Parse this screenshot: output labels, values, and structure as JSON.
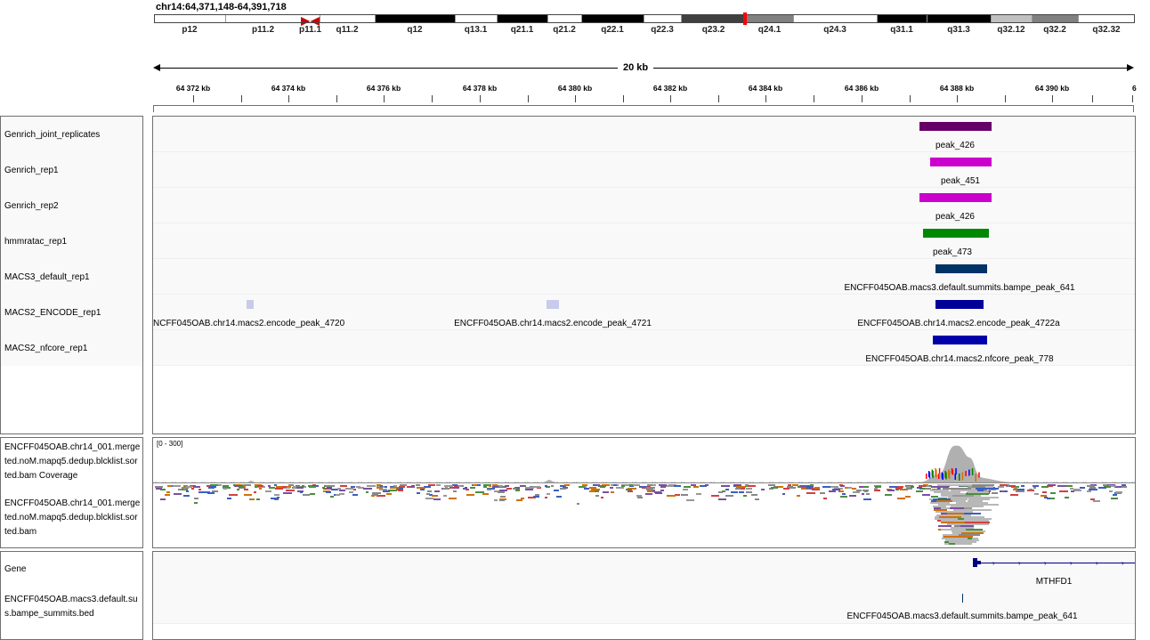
{
  "header": {
    "locus": "chr14:64,371,148-64,391,718",
    "scale_label": "20 kb"
  },
  "ideogram": {
    "bands": [
      {
        "label": "p12",
        "start": 0,
        "end": 80,
        "color": "#ffffff"
      },
      {
        "label": "p11.2",
        "start": 80,
        "end": 165,
        "color": "#ffffff"
      },
      {
        "label": "p11.1",
        "start": 165,
        "end": 186,
        "color": "#ffffff",
        "centromere": true
      },
      {
        "label": "q11.2",
        "start": 186,
        "end": 248,
        "color": "#ffffff"
      },
      {
        "label": "q12",
        "start": 248,
        "end": 338,
        "color": "#000000"
      },
      {
        "label": "q13.1",
        "start": 338,
        "end": 385,
        "color": "#ffffff"
      },
      {
        "label": "q21.1",
        "start": 385,
        "end": 442,
        "color": "#000000"
      },
      {
        "label": "q21.2",
        "start": 442,
        "end": 480,
        "color": "#ffffff"
      },
      {
        "label": "q22.1",
        "start": 480,
        "end": 550,
        "color": "#000000"
      },
      {
        "label": "q22.3",
        "start": 550,
        "end": 592,
        "color": "#ffffff"
      },
      {
        "label": "q23.2",
        "start": 592,
        "end": 665,
        "color": "#404040"
      },
      {
        "label": "q24.1",
        "start": 665,
        "end": 718,
        "color": "#808080"
      },
      {
        "label": "q24.3",
        "start": 718,
        "end": 812,
        "color": "#ffffff"
      },
      {
        "label": "q31.1",
        "start": 812,
        "end": 868,
        "color": "#000000"
      },
      {
        "label": "q31.3",
        "start": 868,
        "end": 940,
        "color": "#000000"
      },
      {
        "label": "q32.12",
        "start": 940,
        "end": 986,
        "color": "#c0c0c0"
      },
      {
        "label": "q32.2",
        "start": 986,
        "end": 1038,
        "color": "#808080"
      },
      {
        "label": "q32.32",
        "start": 1038,
        "end": 1102,
        "color": "#ffffff"
      }
    ]
  },
  "ruler": {
    "ticks": [
      {
        "label": "64 372 kb"
      },
      {
        "label": "64 374 kb"
      },
      {
        "label": "64 376 kb"
      },
      {
        "label": "64 378 kb"
      },
      {
        "label": "64 380 kb"
      },
      {
        "label": "64 382 kb"
      },
      {
        "label": "64 384 kb"
      },
      {
        "label": "64 386 kb"
      },
      {
        "label": "64 388 kb"
      },
      {
        "label": "64 390 kb"
      },
      {
        "label": "6"
      }
    ]
  },
  "tracks": [
    {
      "name": "Genrich_joint_replicates",
      "color": "#660066",
      "features": [
        {
          "label": "peak_426"
        }
      ]
    },
    {
      "name": "Genrich_rep1",
      "color": "#cc00cc",
      "features": [
        {
          "label": "peak_451"
        }
      ]
    },
    {
      "name": "Genrich_rep2",
      "color": "#cc00cc",
      "features": [
        {
          "label": "peak_426"
        }
      ]
    },
    {
      "name": "hmmratac_rep1",
      "color": "#008800",
      "features": [
        {
          "label": "peak_473"
        }
      ]
    },
    {
      "name": "MACS3_default_rep1",
      "color": "#003366",
      "features": [
        {
          "label": "ENCFF045OAB.macs3.default.summits.bampe_peak_641"
        }
      ]
    },
    {
      "name": "MACS2_ENCODE_rep1",
      "color": "#000099",
      "features": [
        {
          "label": "NCFF045OAB.chr14.macs2.encode_peak_4720",
          "faint": true
        },
        {
          "label": "ENCFF045OAB.chr14.macs2.encode_peak_4721",
          "faint": true
        },
        {
          "label": "ENCFF045OAB.chr14.macs2.encode_peak_4722a"
        }
      ]
    },
    {
      "name": "MACS2_nfcore_rep1",
      "color": "#0000aa",
      "features": [
        {
          "label": "ENCFF045OAB.chr14.macs2.nfcore_peak_778"
        }
      ]
    }
  ],
  "alignment": {
    "coverage_name_lines": [
      "ENCFF045OAB.chr14_001.merge",
      "ted.noM.mapq5.dedup.blcklist.sor",
      "ted.bam Coverage"
    ],
    "bam_name_lines": [
      "ENCFF045OAB.chr14_001.merge",
      "ted.noM.mapq5.dedup.blcklist.sor",
      "ted.bam"
    ],
    "data_range": "[0 - 300]"
  },
  "bottom": {
    "gene_track_name": "Gene",
    "gene_label": "MTHFD1",
    "summits_name_lines": [
      "ENCFF045OAB.macs3.default.su",
      "s.bampe_summits.bed"
    ],
    "summits_label": "ENCFF045OAB.macs3.default.summits.bampe_peak_641"
  },
  "colors": {
    "border": "#6f6f6f",
    "coverage": "#b0b0b0",
    "ideogram_centromere": "#cc0000",
    "ideogram_marker": "#ff0000"
  }
}
